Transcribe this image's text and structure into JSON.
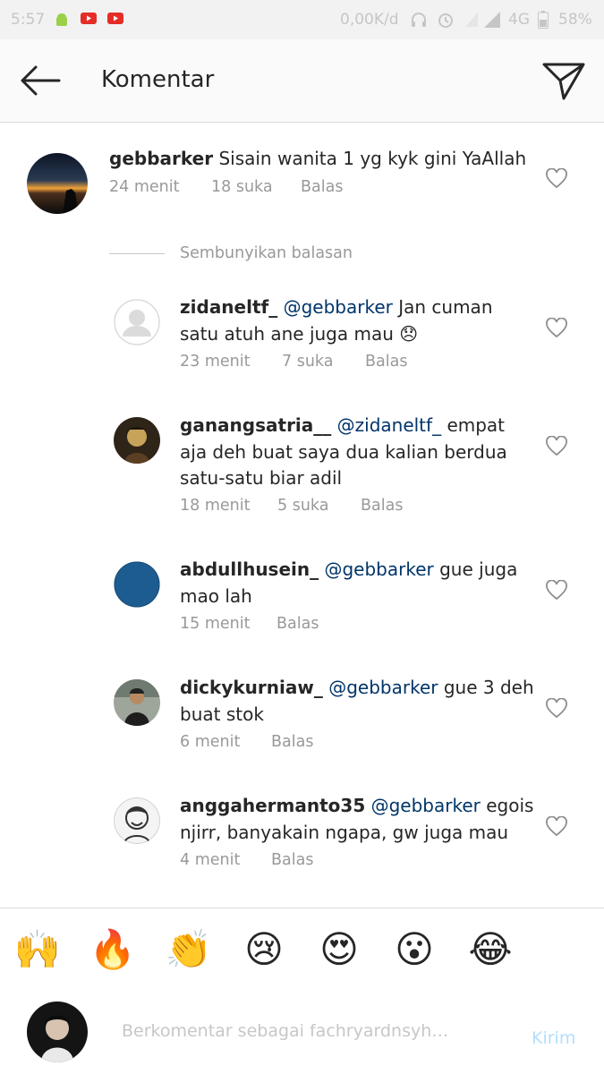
{
  "status_bar": {
    "time": "5:57",
    "speed": "0,00K/d",
    "network": "4G",
    "battery": "58%"
  },
  "header": {
    "title": "Komentar"
  },
  "main_comment": {
    "username": "gebbarker",
    "text": "Sisain wanita 1 yg kyk gini YaAllah",
    "time": "24 menit",
    "likes": "18 suka",
    "reply": "Balas"
  },
  "hide_replies": "Sembunyikan balasan",
  "replies": [
    {
      "username": "zidaneltf_",
      "mention": "@gebbarker",
      "line1_rest": "Jan cuman",
      "line2": "satu atuh ane juga mau",
      "emoji": "😞",
      "time": "23 menit",
      "likes": "7 suka",
      "reply": "Balas"
    },
    {
      "username": "ganangsatria__",
      "mention": "@zidaneltf_",
      "line1_rest": "empat",
      "line2": "aja deh buat saya dua kalian berdua",
      "line3": "satu-satu biar adil",
      "time": "18 menit",
      "likes": "5 suka",
      "reply": "Balas"
    },
    {
      "username": "abdullhusein_",
      "mention": "@gebbarker",
      "line1_rest": "gue juga",
      "line2": "mao lah",
      "time": "15 menit",
      "reply": "Balas"
    },
    {
      "username": "dickykurniaw_",
      "mention": "@gebbarker",
      "line1_rest": "gue 3 deh",
      "line2": "buat stok",
      "time": "6 menit",
      "reply": "Balas"
    },
    {
      "username": "anggahermanto35",
      "mention": "@gebbarker",
      "line1_rest": "egois",
      "line2": "njirr, banyakain ngapa, gw juga mau",
      "time": "4 menit",
      "reply": "Balas"
    }
  ],
  "emoji_bar": [
    "🙌",
    "🔥",
    "👏",
    "😢",
    "😍",
    "😮",
    "😂"
  ],
  "input": {
    "placeholder": "Berkomentar sebagai fachryardnsyh…",
    "send_label": "Kirim"
  },
  "colors": {
    "mention": "#003569",
    "meta": "#999999",
    "send_disabled": "#b2dffc",
    "avatar_abdull": "#1d5c91"
  }
}
